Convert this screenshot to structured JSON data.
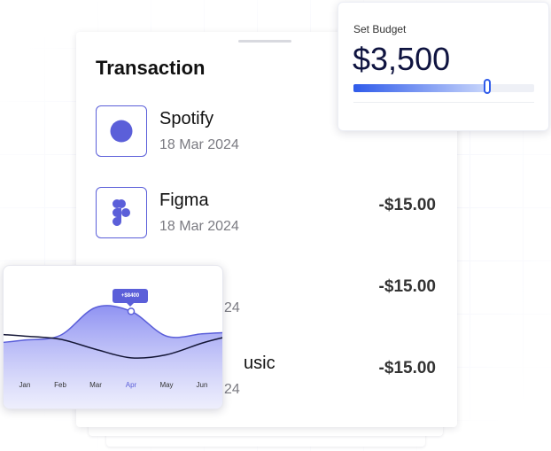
{
  "transaction": {
    "title": "Transaction",
    "items": [
      {
        "name": "Spotify",
        "date": "18 Mar 2024",
        "amount": "",
        "icon": "spotify-icon"
      },
      {
        "name": "Figma",
        "date": "18 Mar 2024",
        "amount": "-$15.00",
        "icon": "figma-icon"
      },
      {
        "name": "",
        "date": "24",
        "amount": "-$15.00",
        "icon": "app-icon"
      },
      {
        "name": "usic",
        "date": "24",
        "amount": "-$15.00",
        "icon": "music-icon"
      }
    ]
  },
  "budget": {
    "label": "Set Budget",
    "value": "$3,500",
    "slider_level": 0.74
  },
  "chart_data": {
    "type": "area",
    "categories": [
      "Jan",
      "Feb",
      "Mar",
      "Apr",
      "May",
      "Jun"
    ],
    "active_category": "Apr",
    "tooltip": "+$8400",
    "series": [
      {
        "values": [
          2,
          2.6,
          6.2,
          5.7,
          2.5,
          2.8
        ]
      },
      {
        "values": [
          2.5,
          2.1,
          0.8,
          -0.3,
          0.1,
          1.6
        ]
      }
    ]
  },
  "colors": {
    "accent": "#5b5fd9",
    "budget_fill": "#2f5bea",
    "dark_line": "#141636"
  }
}
